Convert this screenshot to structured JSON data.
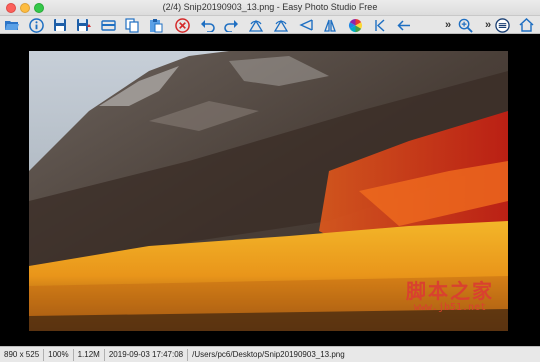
{
  "window": {
    "title": "(2/4) Snip20190903_13.png - Easy Photo Studio Free"
  },
  "toolbar": {
    "items": [
      {
        "name": "open-folder-icon"
      },
      {
        "name": "info-icon"
      },
      {
        "name": "save-icon"
      },
      {
        "name": "save-as-icon"
      },
      {
        "name": "scan-icon"
      },
      {
        "name": "copy-icon"
      },
      {
        "name": "paste-icon"
      },
      {
        "name": "delete-icon"
      },
      {
        "name": "undo-icon"
      },
      {
        "name": "redo-icon"
      },
      {
        "name": "rotate-left-icon"
      },
      {
        "name": "rotate-right-icon"
      },
      {
        "name": "flip-horizontal-icon"
      },
      {
        "name": "flip-vertical-icon"
      },
      {
        "name": "color-wheel-icon"
      },
      {
        "name": "first-image-icon"
      },
      {
        "name": "previous-image-icon"
      },
      {
        "name": "zoom-in-icon"
      },
      {
        "name": "home-icon"
      }
    ],
    "overflow_label": "»"
  },
  "watermark": {
    "chinese": "脚本之家",
    "url": "www.jb51.net"
  },
  "status": {
    "dimensions": "890 x 525",
    "zoom": "100%",
    "filesize": "1.12M",
    "datetime": "2019-09-03 17:47:08",
    "path": "/Users/pc6/Desktop/Snip20190903_13.png"
  },
  "colors": {
    "toolbar_icon_blue": "#1e6fc2",
    "close_red": "#d42a2a",
    "status_bg": "#e8e8e8"
  }
}
